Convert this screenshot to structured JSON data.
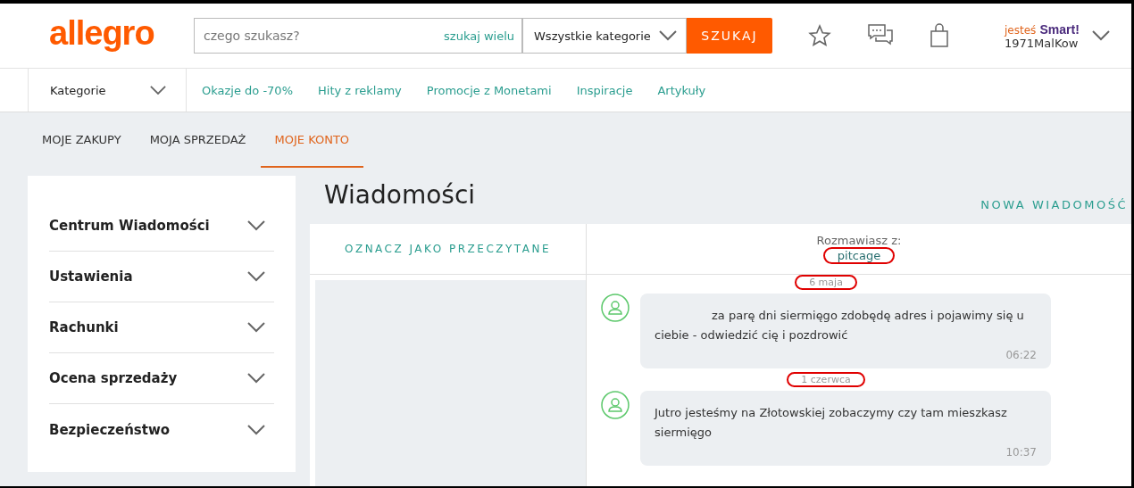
{
  "header": {
    "logo": "allegro",
    "search": {
      "placeholder": "czego szukasz?",
      "multi_link": "szukaj wielu",
      "category": "Wszystkie kategorie",
      "button": "SZUKAJ"
    },
    "user": {
      "prefix": "jesteś",
      "badge": "Smart!",
      "name": "1971MalKow"
    }
  },
  "nav": {
    "categories": "Kategorie",
    "links": [
      "Okazje do -70%",
      "Hity z reklamy",
      "Promocje z Monetami",
      "Inspiracje",
      "Artykuły"
    ]
  },
  "tabs": [
    {
      "label": "MOJE ZAKUPY",
      "selected": false
    },
    {
      "label": "MOJA SPRZEDAŻ",
      "selected": false
    },
    {
      "label": "MOJE KONTO",
      "selected": true
    }
  ],
  "sidebar": {
    "items": [
      {
        "label": "Centrum Wiadomości",
        "expanded": false
      },
      {
        "label": "Ustawienia",
        "expanded": false
      },
      {
        "label": "Rachunki",
        "expanded": false
      },
      {
        "label": "Ocena sprzedaży",
        "expanded": false
      },
      {
        "label": "Bezpieczeństwo",
        "expanded": false
      }
    ]
  },
  "page_title": "Wiadomości",
  "new_message": "NOWA WIADOMOŚĆ",
  "mark_read": "OZNACZ JAKO PRZECZYTANE",
  "conversation": {
    "with_label": "Rozmawiasz z:",
    "partner": {
      "name": "pitcage",
      "circled": true
    },
    "messages": [
      {
        "date": "6 maja",
        "date_circled": true,
        "text": "za parę dni siermięgo zdobędę adres i pojawimy się u ciebie - odwiedzić cię i pozdrowić",
        "indented": true,
        "time": "06:22"
      },
      {
        "date": "1 czerwca",
        "date_circled": true,
        "text": "Jutro jesteśmy na Złotowskiej zobaczymy czy tam mieszkasz siermięgo",
        "indented": false,
        "time": "10:37"
      }
    ]
  }
}
